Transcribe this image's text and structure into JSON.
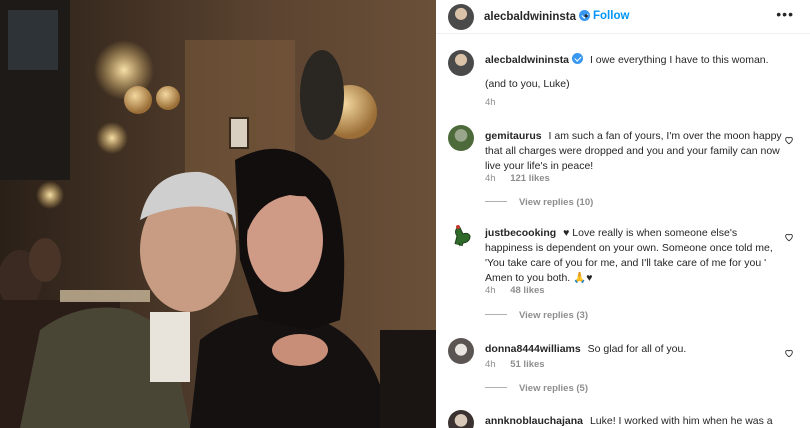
{
  "post": {
    "username": "alecbaldwininsta",
    "follow_label": "Follow",
    "more_label": "•••",
    "caption_line1": "I owe everything I have to this woman.",
    "caption_line2": "(and to you, Luke)",
    "caption_time": "4h"
  },
  "comments": [
    {
      "username": "gemitaurus",
      "text": "I am such a fan of yours, I'm over the moon happy that all charges were dropped and you and your family can now live your life's in peace!",
      "time": "4h",
      "likes": "121 likes",
      "replies": "View replies (10)"
    },
    {
      "username": "justbecooking",
      "text": "♥ Love really is when someone else's happiness is dependent on your own. Someone once told me, 'You take care of you for me, and I'll take care of me for you ' Amen to you both. 🙏♥",
      "time": "4h",
      "likes": "48 likes",
      "replies": "View replies (3)"
    },
    {
      "username": "donna8444williams",
      "text": "So glad for all of you.",
      "time": "4h",
      "likes": "51 likes",
      "replies": "View replies (5)"
    },
    {
      "username": "annknoblauchajana",
      "text": "Luke! I worked with him when he was a"
    }
  ],
  "colors": {
    "accent": "#0095f6",
    "verified": "#3897f0",
    "muted": "#8e8e8e"
  },
  "icons": [
    "verified-badge-icon",
    "more-options-icon",
    "heart-icon"
  ]
}
